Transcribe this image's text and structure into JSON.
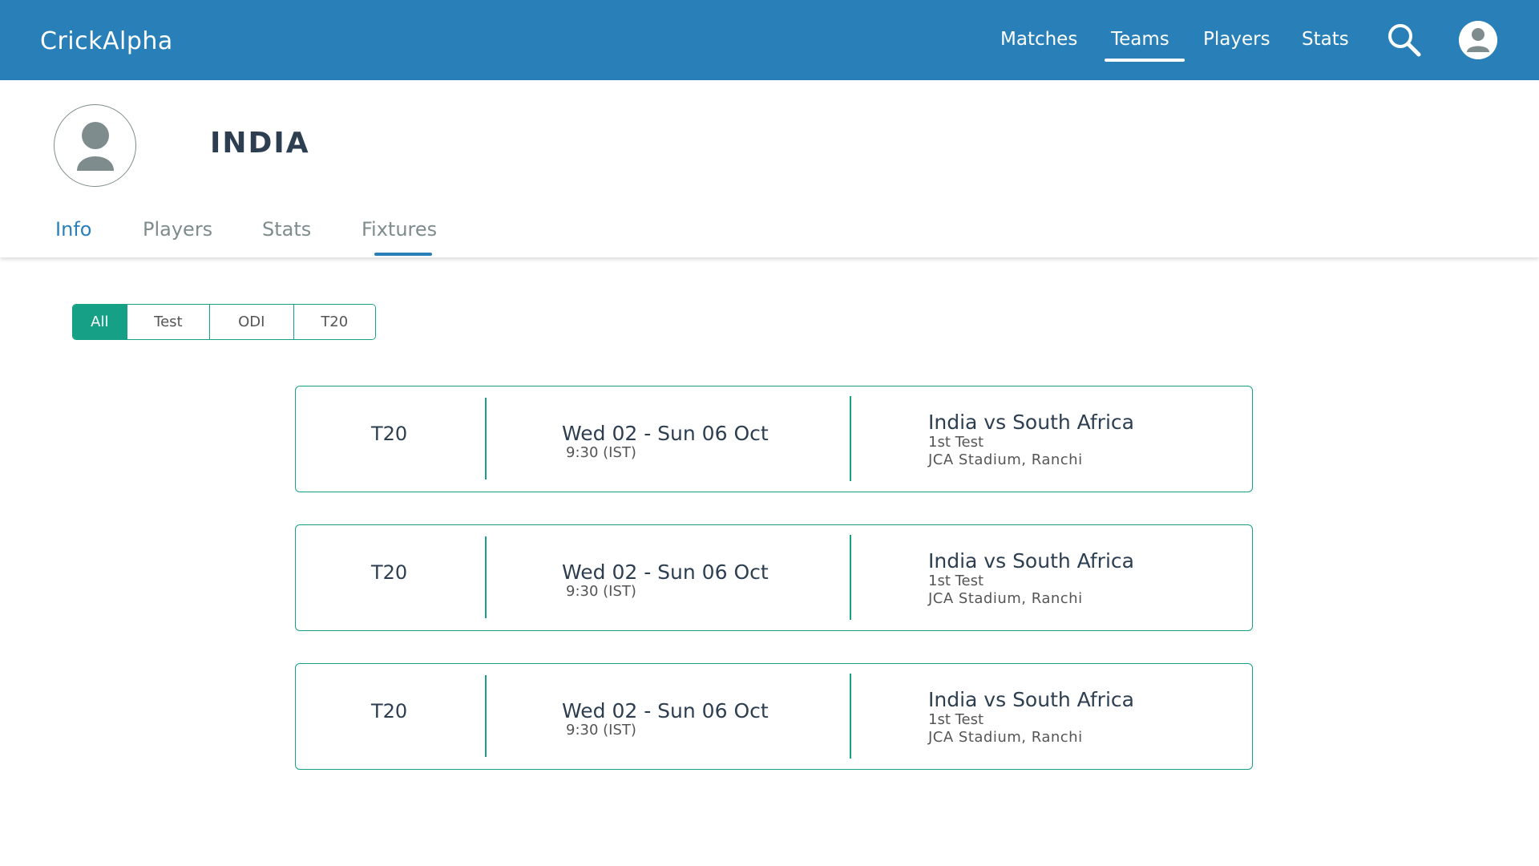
{
  "app": {
    "brand": "CrickAlpha"
  },
  "nav": {
    "items": [
      {
        "label": "Matches"
      },
      {
        "label": "Teams"
      },
      {
        "label": "Players"
      },
      {
        "label": "Stats"
      }
    ],
    "active": "Teams",
    "search_icon": "search-icon",
    "profile_icon": "user-avatar-icon"
  },
  "team": {
    "name": "INDIA",
    "logo_icon": "person-silhouette-icon",
    "tabs": [
      {
        "label": "Info"
      },
      {
        "label": "Players"
      },
      {
        "label": "Stats"
      },
      {
        "label": "Fixtures"
      }
    ],
    "active_tab_text_color": "Info",
    "active_tab_underline": "Fixtures"
  },
  "filter": {
    "options": [
      {
        "label": "All"
      },
      {
        "label": "Test"
      },
      {
        "label": "ODI"
      },
      {
        "label": "T20"
      }
    ],
    "selected": "All"
  },
  "fixtures": [
    {
      "format": "T20",
      "dates": "Wed 02 - Sun 06 Oct",
      "time": "9:30 (IST)",
      "match": "India vs South Africa",
      "series": "1st Test",
      "venue": "JCA Stadium, Ranchi"
    },
    {
      "format": "T20",
      "dates": "Wed 02 - Sun 06 Oct",
      "time": "9:30 (IST)",
      "match": "India vs South Africa",
      "series": "1st Test",
      "venue": "JCA Stadium, Ranchi"
    },
    {
      "format": "T20",
      "dates": "Wed 02 - Sun 06 Oct",
      "time": "9:30 (IST)",
      "match": "India vs South Africa",
      "series": "1st Test",
      "venue": "JCA Stadium, Ranchi"
    }
  ],
  "colors": {
    "primary": "#2980b9",
    "accent": "#16a085",
    "text_dark": "#2c3e50",
    "text_muted": "#7f8c8d"
  }
}
